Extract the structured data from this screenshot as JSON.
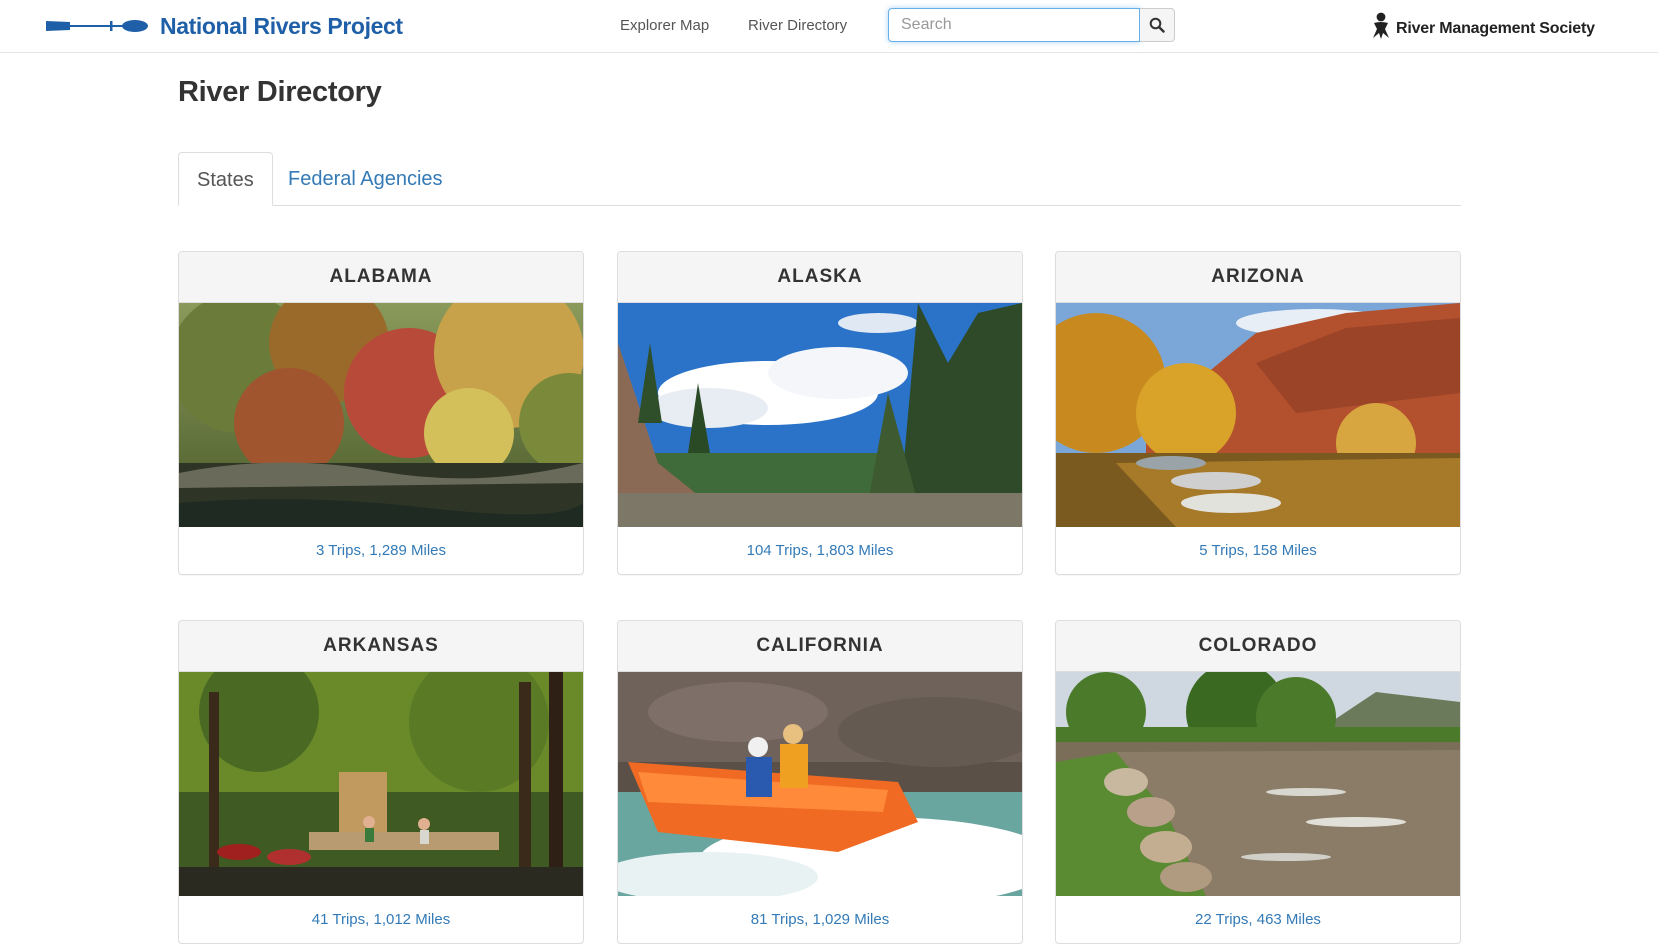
{
  "header": {
    "brand_name": "National Rivers Project",
    "nav": [
      {
        "label": "Explorer Map"
      },
      {
        "label": "River Directory"
      }
    ],
    "search": {
      "placeholder": "Search",
      "value": ""
    },
    "partner_name": "River Management Society",
    "brand_color": "#1f5fa8",
    "link_color": "#337ab7"
  },
  "page": {
    "title": "River Directory",
    "tabs": [
      {
        "label": "States",
        "active": true
      },
      {
        "label": "Federal Agencies",
        "active": false
      }
    ]
  },
  "states": [
    {
      "name": "ALABAMA",
      "stats": "3 Trips, 1,289 Miles",
      "photo": "autumn-river-bank"
    },
    {
      "name": "ALASKA",
      "stats": "104 Trips, 1,803 Miles",
      "photo": "spruce-forest-river"
    },
    {
      "name": "ARIZONA",
      "stats": "5 Trips, 158 Miles",
      "photo": "canyon-rafts-autumn"
    },
    {
      "name": "ARKANSAS",
      "stats": "41 Trips, 1,012 Miles",
      "photo": "cypress-swamp-dock"
    },
    {
      "name": "CALIFORNIA",
      "stats": "81 Trips, 1,029 Miles",
      "photo": "whitewater-raft"
    },
    {
      "name": "COLORADO",
      "stats": "22 Trips, 463 Miles",
      "photo": "rocky-bank-rapids"
    }
  ]
}
